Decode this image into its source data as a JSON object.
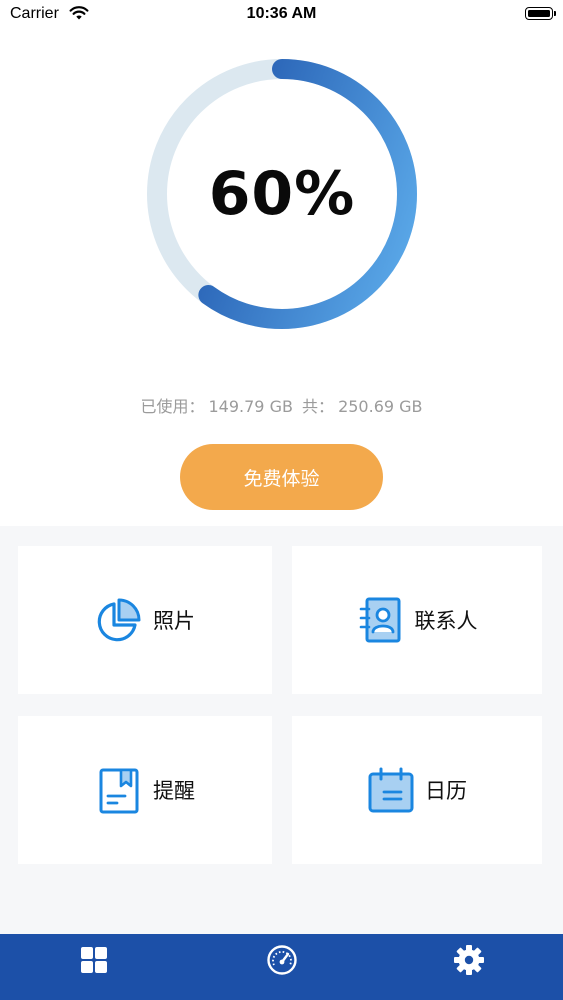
{
  "status_bar": {
    "carrier": "Carrier",
    "time": "10:36 AM"
  },
  "storage": {
    "percent_label": "60%",
    "used_fraction": 0.6,
    "used_label": "已使用：",
    "used_value": "149.79 GB",
    "total_label": "共：",
    "total_value": "250.69 GB",
    "ring_colors": {
      "track": "#dce8f0",
      "start": "#1c50a8",
      "end": "#5aa8e8"
    }
  },
  "trial_button": {
    "label": "免费体验",
    "color": "#f3a94c"
  },
  "categories": [
    {
      "label": "照片",
      "icon": "pie-chart-icon"
    },
    {
      "label": "联系人",
      "icon": "contact-book-icon"
    },
    {
      "label": "提醒",
      "icon": "reminder-book-icon"
    },
    {
      "label": "日历",
      "icon": "calendar-icon"
    }
  ],
  "tab_bar": {
    "color": "#1c50a8",
    "tabs": [
      {
        "icon": "grid-icon"
      },
      {
        "icon": "speedometer-icon"
      },
      {
        "icon": "gear-icon"
      }
    ]
  }
}
